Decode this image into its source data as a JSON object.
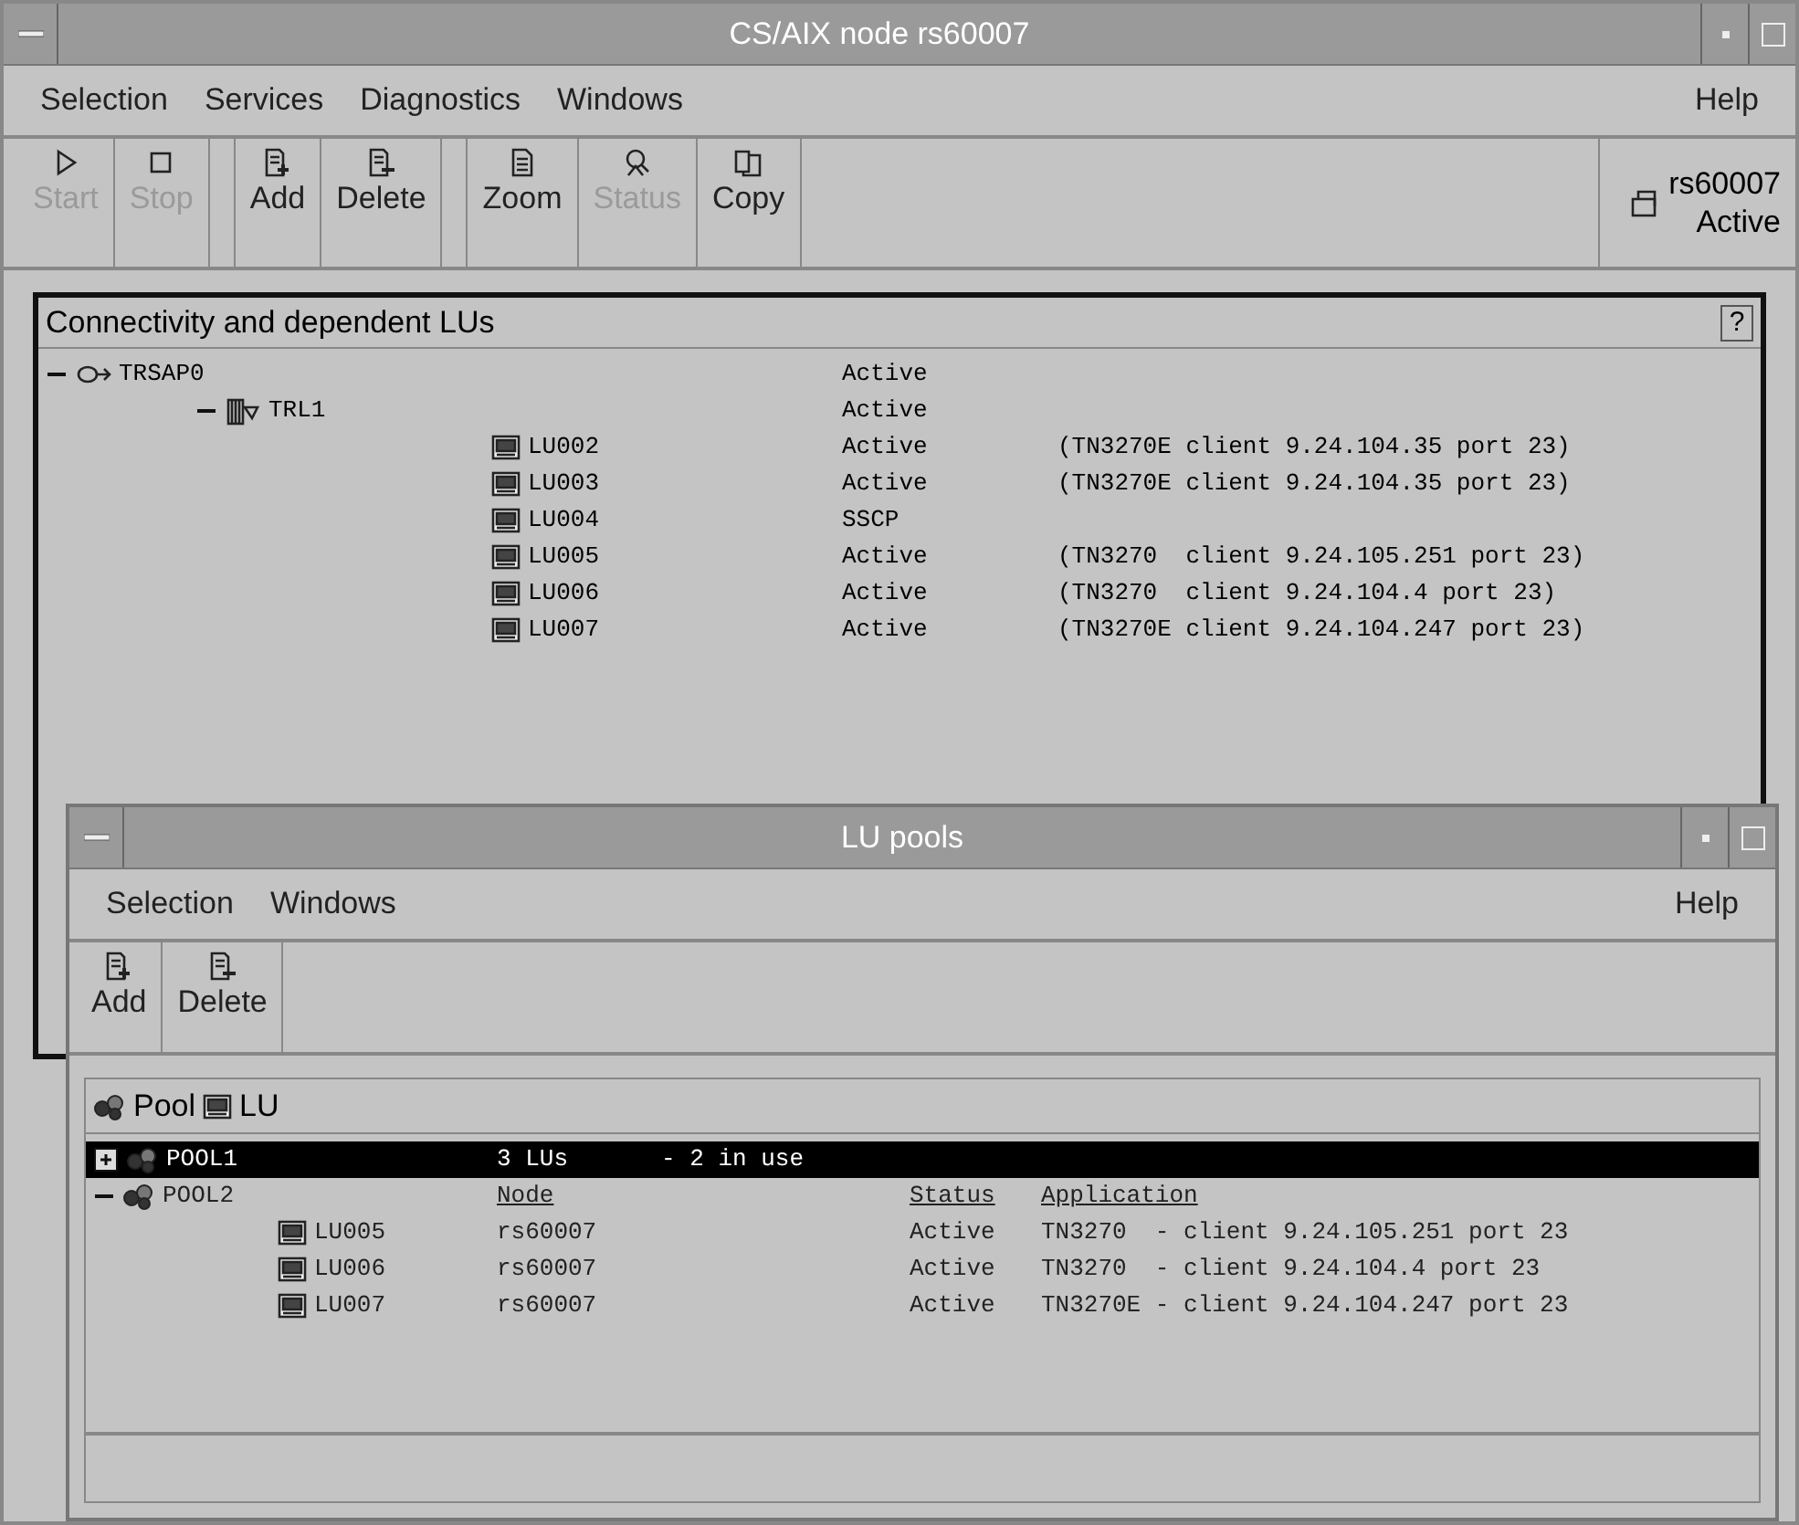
{
  "main_window": {
    "title": "CS/AIX node rs60007",
    "menu": [
      {
        "label": "Selection"
      },
      {
        "label": "Services"
      },
      {
        "label": "Diagnostics"
      },
      {
        "label": "Windows"
      }
    ],
    "help_menu": "Help",
    "toolbar": [
      {
        "label": "Start",
        "kind": "start",
        "disabled": true
      },
      {
        "label": "Stop",
        "kind": "stop",
        "disabled": true
      },
      {
        "label": "Add",
        "kind": "add",
        "disabled": false
      },
      {
        "label": "Delete",
        "kind": "delete",
        "disabled": false
      },
      {
        "label": "Zoom",
        "kind": "zoom",
        "disabled": false
      },
      {
        "label": "Status",
        "kind": "status",
        "disabled": true
      },
      {
        "label": "Copy",
        "kind": "copy",
        "disabled": false
      }
    ],
    "node": {
      "name": "rs60007",
      "status": "Active"
    },
    "panel": {
      "title": "Connectivity and dependent LUs",
      "help": "?",
      "tree": [
        {
          "name": "TRSAP0",
          "kind": "port",
          "expanded": true,
          "status": "Active",
          "children": [
            {
              "name": "TRL1",
              "kind": "link",
              "expanded": true,
              "status": "Active",
              "children": [
                {
                  "name": "LU002",
                  "kind": "lu",
                  "status": "Active",
                  "detail": "(TN3270E client 9.24.104.35 port 23)"
                },
                {
                  "name": "LU003",
                  "kind": "lu",
                  "status": "Active",
                  "detail": "(TN3270E client 9.24.104.35 port 23)"
                },
                {
                  "name": "LU004",
                  "kind": "lu",
                  "status": "SSCP"
                },
                {
                  "name": "LU005",
                  "kind": "lu",
                  "status": "Active",
                  "detail": "(TN3270  client 9.24.105.251 port 23)"
                },
                {
                  "name": "LU006",
                  "kind": "lu",
                  "status": "Active",
                  "detail": "(TN3270  client 9.24.104.4 port 23)"
                },
                {
                  "name": "LU007",
                  "kind": "lu",
                  "status": "Active",
                  "detail": "(TN3270E client 9.24.104.247 port 23)"
                }
              ]
            }
          ]
        }
      ]
    }
  },
  "pools_window": {
    "title": "LU pools",
    "menu": [
      {
        "label": "Selection"
      },
      {
        "label": "Windows"
      }
    ],
    "help_menu": "Help",
    "toolbar": [
      {
        "label": "Add",
        "kind": "add",
        "disabled": false
      },
      {
        "label": "Delete",
        "kind": "delete",
        "disabled": false
      }
    ],
    "legend": [
      {
        "label": "Pool",
        "kind": "pool"
      },
      {
        "label": "LU",
        "kind": "lu"
      }
    ],
    "pools": [
      {
        "name": "POOL1",
        "expanded": false,
        "selected": true,
        "count": "3 LUs",
        "usage": "- 2 in use"
      },
      {
        "name": "POOL2",
        "expanded": true,
        "selected": false,
        "columns": [
          "Node",
          "Status",
          "Application"
        ],
        "children": [
          {
            "name": "LU005",
            "node": "rs60007",
            "status": "Active",
            "application": "TN3270  - client 9.24.105.251 port 23"
          },
          {
            "name": "LU006",
            "node": "rs60007",
            "status": "Active",
            "application": "TN3270  - client 9.24.104.4 port 23"
          },
          {
            "name": "LU007",
            "node": "rs60007",
            "status": "Active",
            "application": "TN3270E - client 9.24.104.247 port 23"
          }
        ]
      }
    ]
  }
}
